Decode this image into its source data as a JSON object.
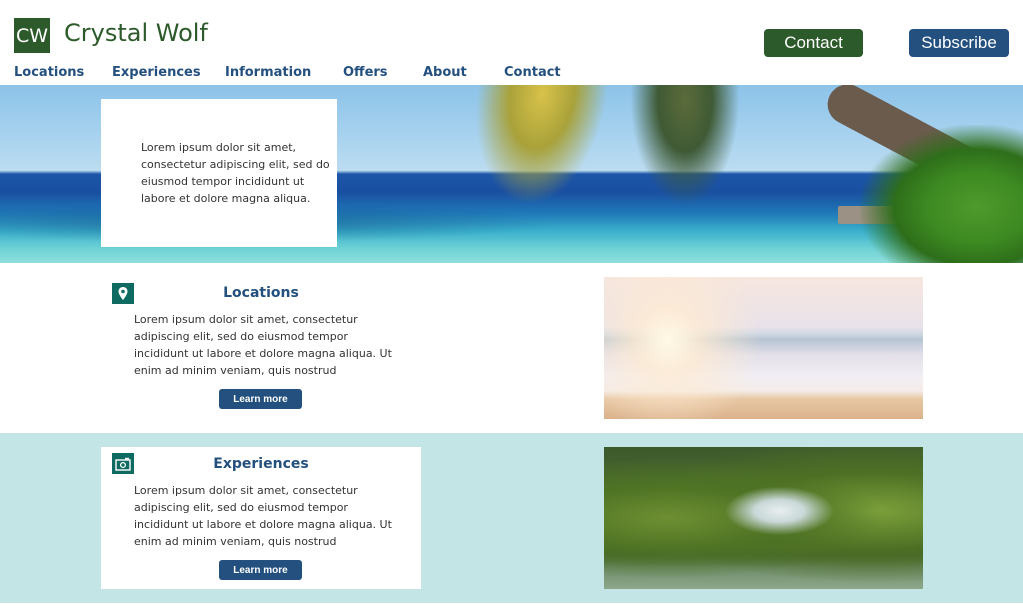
{
  "header": {
    "logo_text": "CW",
    "brand_name": "Crystal Wolf",
    "contact_button": "Contact",
    "subscribe_button": "Subscribe"
  },
  "nav": {
    "items": [
      {
        "label": "Locations"
      },
      {
        "label": "Experiences"
      },
      {
        "label": "Information"
      },
      {
        "label": "Offers"
      },
      {
        "label": "About"
      },
      {
        "label": "Contact"
      }
    ]
  },
  "hero": {
    "image": "tropical-beach-palm-photo",
    "card_text": "Lorem ipsum dolor sit amet, consectetur adipiscing elit, sed do eiusmod tempor incididunt ut labore et dolore magna aliqua."
  },
  "sections": [
    {
      "icon": "map-pin-icon",
      "title": "Locations",
      "text": "Lorem ipsum dolor sit amet, consectetur adipiscing elit, sed do eiusmod tempor incididunt ut labore et dolore magna aliqua. Ut enim ad minim veniam, quis nostrud",
      "button": "Learn more",
      "image": "sunset-beach-waves-photo"
    },
    {
      "icon": "camera-icon",
      "title": "Experiences",
      "text": "Lorem ipsum dolor sit amet, consectetur adipiscing elit, sed do eiusmod tempor incididunt ut labore et dolore magna aliqua. Ut enim ad minim veniam, quis nostrud",
      "button": "Learn more",
      "image": "mossy-waterfall-photo"
    }
  ],
  "colors": {
    "brand_green": "#2d5a2b",
    "brand_blue": "#24507f",
    "icon_teal": "#0f6b61",
    "section_teal_bg": "#c3e5e6"
  }
}
